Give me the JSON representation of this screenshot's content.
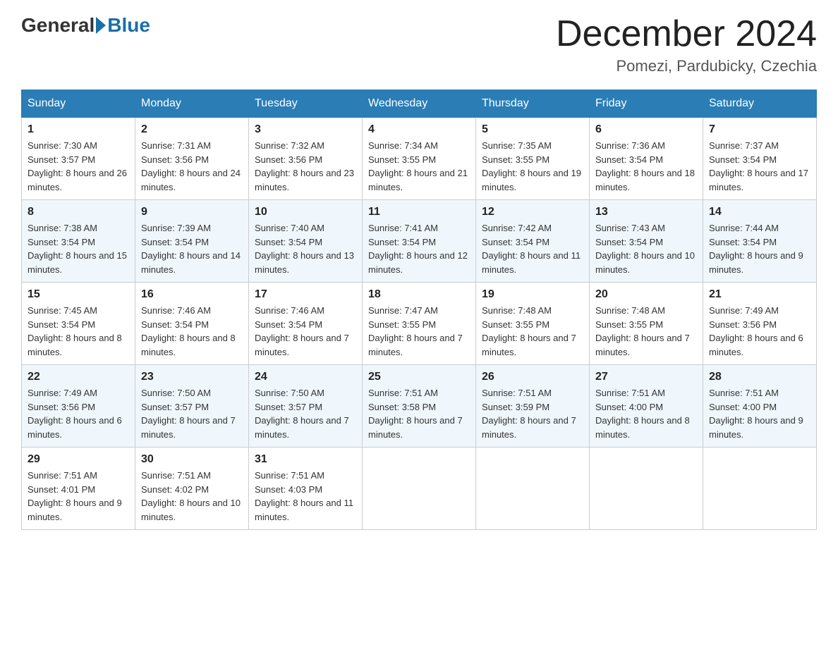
{
  "header": {
    "logo_text_general": "General",
    "logo_text_blue": "Blue",
    "title": "December 2024",
    "subtitle": "Pomezi, Pardubicky, Czechia"
  },
  "weekdays": [
    "Sunday",
    "Monday",
    "Tuesday",
    "Wednesday",
    "Thursday",
    "Friday",
    "Saturday"
  ],
  "weeks": [
    [
      {
        "day": "1",
        "sunrise": "7:30 AM",
        "sunset": "3:57 PM",
        "daylight": "8 hours and 26 minutes."
      },
      {
        "day": "2",
        "sunrise": "7:31 AM",
        "sunset": "3:56 PM",
        "daylight": "8 hours and 24 minutes."
      },
      {
        "day": "3",
        "sunrise": "7:32 AM",
        "sunset": "3:56 PM",
        "daylight": "8 hours and 23 minutes."
      },
      {
        "day": "4",
        "sunrise": "7:34 AM",
        "sunset": "3:55 PM",
        "daylight": "8 hours and 21 minutes."
      },
      {
        "day": "5",
        "sunrise": "7:35 AM",
        "sunset": "3:55 PM",
        "daylight": "8 hours and 19 minutes."
      },
      {
        "day": "6",
        "sunrise": "7:36 AM",
        "sunset": "3:54 PM",
        "daylight": "8 hours and 18 minutes."
      },
      {
        "day": "7",
        "sunrise": "7:37 AM",
        "sunset": "3:54 PM",
        "daylight": "8 hours and 17 minutes."
      }
    ],
    [
      {
        "day": "8",
        "sunrise": "7:38 AM",
        "sunset": "3:54 PM",
        "daylight": "8 hours and 15 minutes."
      },
      {
        "day": "9",
        "sunrise": "7:39 AM",
        "sunset": "3:54 PM",
        "daylight": "8 hours and 14 minutes."
      },
      {
        "day": "10",
        "sunrise": "7:40 AM",
        "sunset": "3:54 PM",
        "daylight": "8 hours and 13 minutes."
      },
      {
        "day": "11",
        "sunrise": "7:41 AM",
        "sunset": "3:54 PM",
        "daylight": "8 hours and 12 minutes."
      },
      {
        "day": "12",
        "sunrise": "7:42 AM",
        "sunset": "3:54 PM",
        "daylight": "8 hours and 11 minutes."
      },
      {
        "day": "13",
        "sunrise": "7:43 AM",
        "sunset": "3:54 PM",
        "daylight": "8 hours and 10 minutes."
      },
      {
        "day": "14",
        "sunrise": "7:44 AM",
        "sunset": "3:54 PM",
        "daylight": "8 hours and 9 minutes."
      }
    ],
    [
      {
        "day": "15",
        "sunrise": "7:45 AM",
        "sunset": "3:54 PM",
        "daylight": "8 hours and 8 minutes."
      },
      {
        "day": "16",
        "sunrise": "7:46 AM",
        "sunset": "3:54 PM",
        "daylight": "8 hours and 8 minutes."
      },
      {
        "day": "17",
        "sunrise": "7:46 AM",
        "sunset": "3:54 PM",
        "daylight": "8 hours and 7 minutes."
      },
      {
        "day": "18",
        "sunrise": "7:47 AM",
        "sunset": "3:55 PM",
        "daylight": "8 hours and 7 minutes."
      },
      {
        "day": "19",
        "sunrise": "7:48 AM",
        "sunset": "3:55 PM",
        "daylight": "8 hours and 7 minutes."
      },
      {
        "day": "20",
        "sunrise": "7:48 AM",
        "sunset": "3:55 PM",
        "daylight": "8 hours and 7 minutes."
      },
      {
        "day": "21",
        "sunrise": "7:49 AM",
        "sunset": "3:56 PM",
        "daylight": "8 hours and 6 minutes."
      }
    ],
    [
      {
        "day": "22",
        "sunrise": "7:49 AM",
        "sunset": "3:56 PM",
        "daylight": "8 hours and 6 minutes."
      },
      {
        "day": "23",
        "sunrise": "7:50 AM",
        "sunset": "3:57 PM",
        "daylight": "8 hours and 7 minutes."
      },
      {
        "day": "24",
        "sunrise": "7:50 AM",
        "sunset": "3:57 PM",
        "daylight": "8 hours and 7 minutes."
      },
      {
        "day": "25",
        "sunrise": "7:51 AM",
        "sunset": "3:58 PM",
        "daylight": "8 hours and 7 minutes."
      },
      {
        "day": "26",
        "sunrise": "7:51 AM",
        "sunset": "3:59 PM",
        "daylight": "8 hours and 7 minutes."
      },
      {
        "day": "27",
        "sunrise": "7:51 AM",
        "sunset": "4:00 PM",
        "daylight": "8 hours and 8 minutes."
      },
      {
        "day": "28",
        "sunrise": "7:51 AM",
        "sunset": "4:00 PM",
        "daylight": "8 hours and 9 minutes."
      }
    ],
    [
      {
        "day": "29",
        "sunrise": "7:51 AM",
        "sunset": "4:01 PM",
        "daylight": "8 hours and 9 minutes."
      },
      {
        "day": "30",
        "sunrise": "7:51 AM",
        "sunset": "4:02 PM",
        "daylight": "8 hours and 10 minutes."
      },
      {
        "day": "31",
        "sunrise": "7:51 AM",
        "sunset": "4:03 PM",
        "daylight": "8 hours and 11 minutes."
      },
      null,
      null,
      null,
      null
    ]
  ],
  "labels": {
    "sunrise": "Sunrise:",
    "sunset": "Sunset:",
    "daylight": "Daylight:"
  }
}
